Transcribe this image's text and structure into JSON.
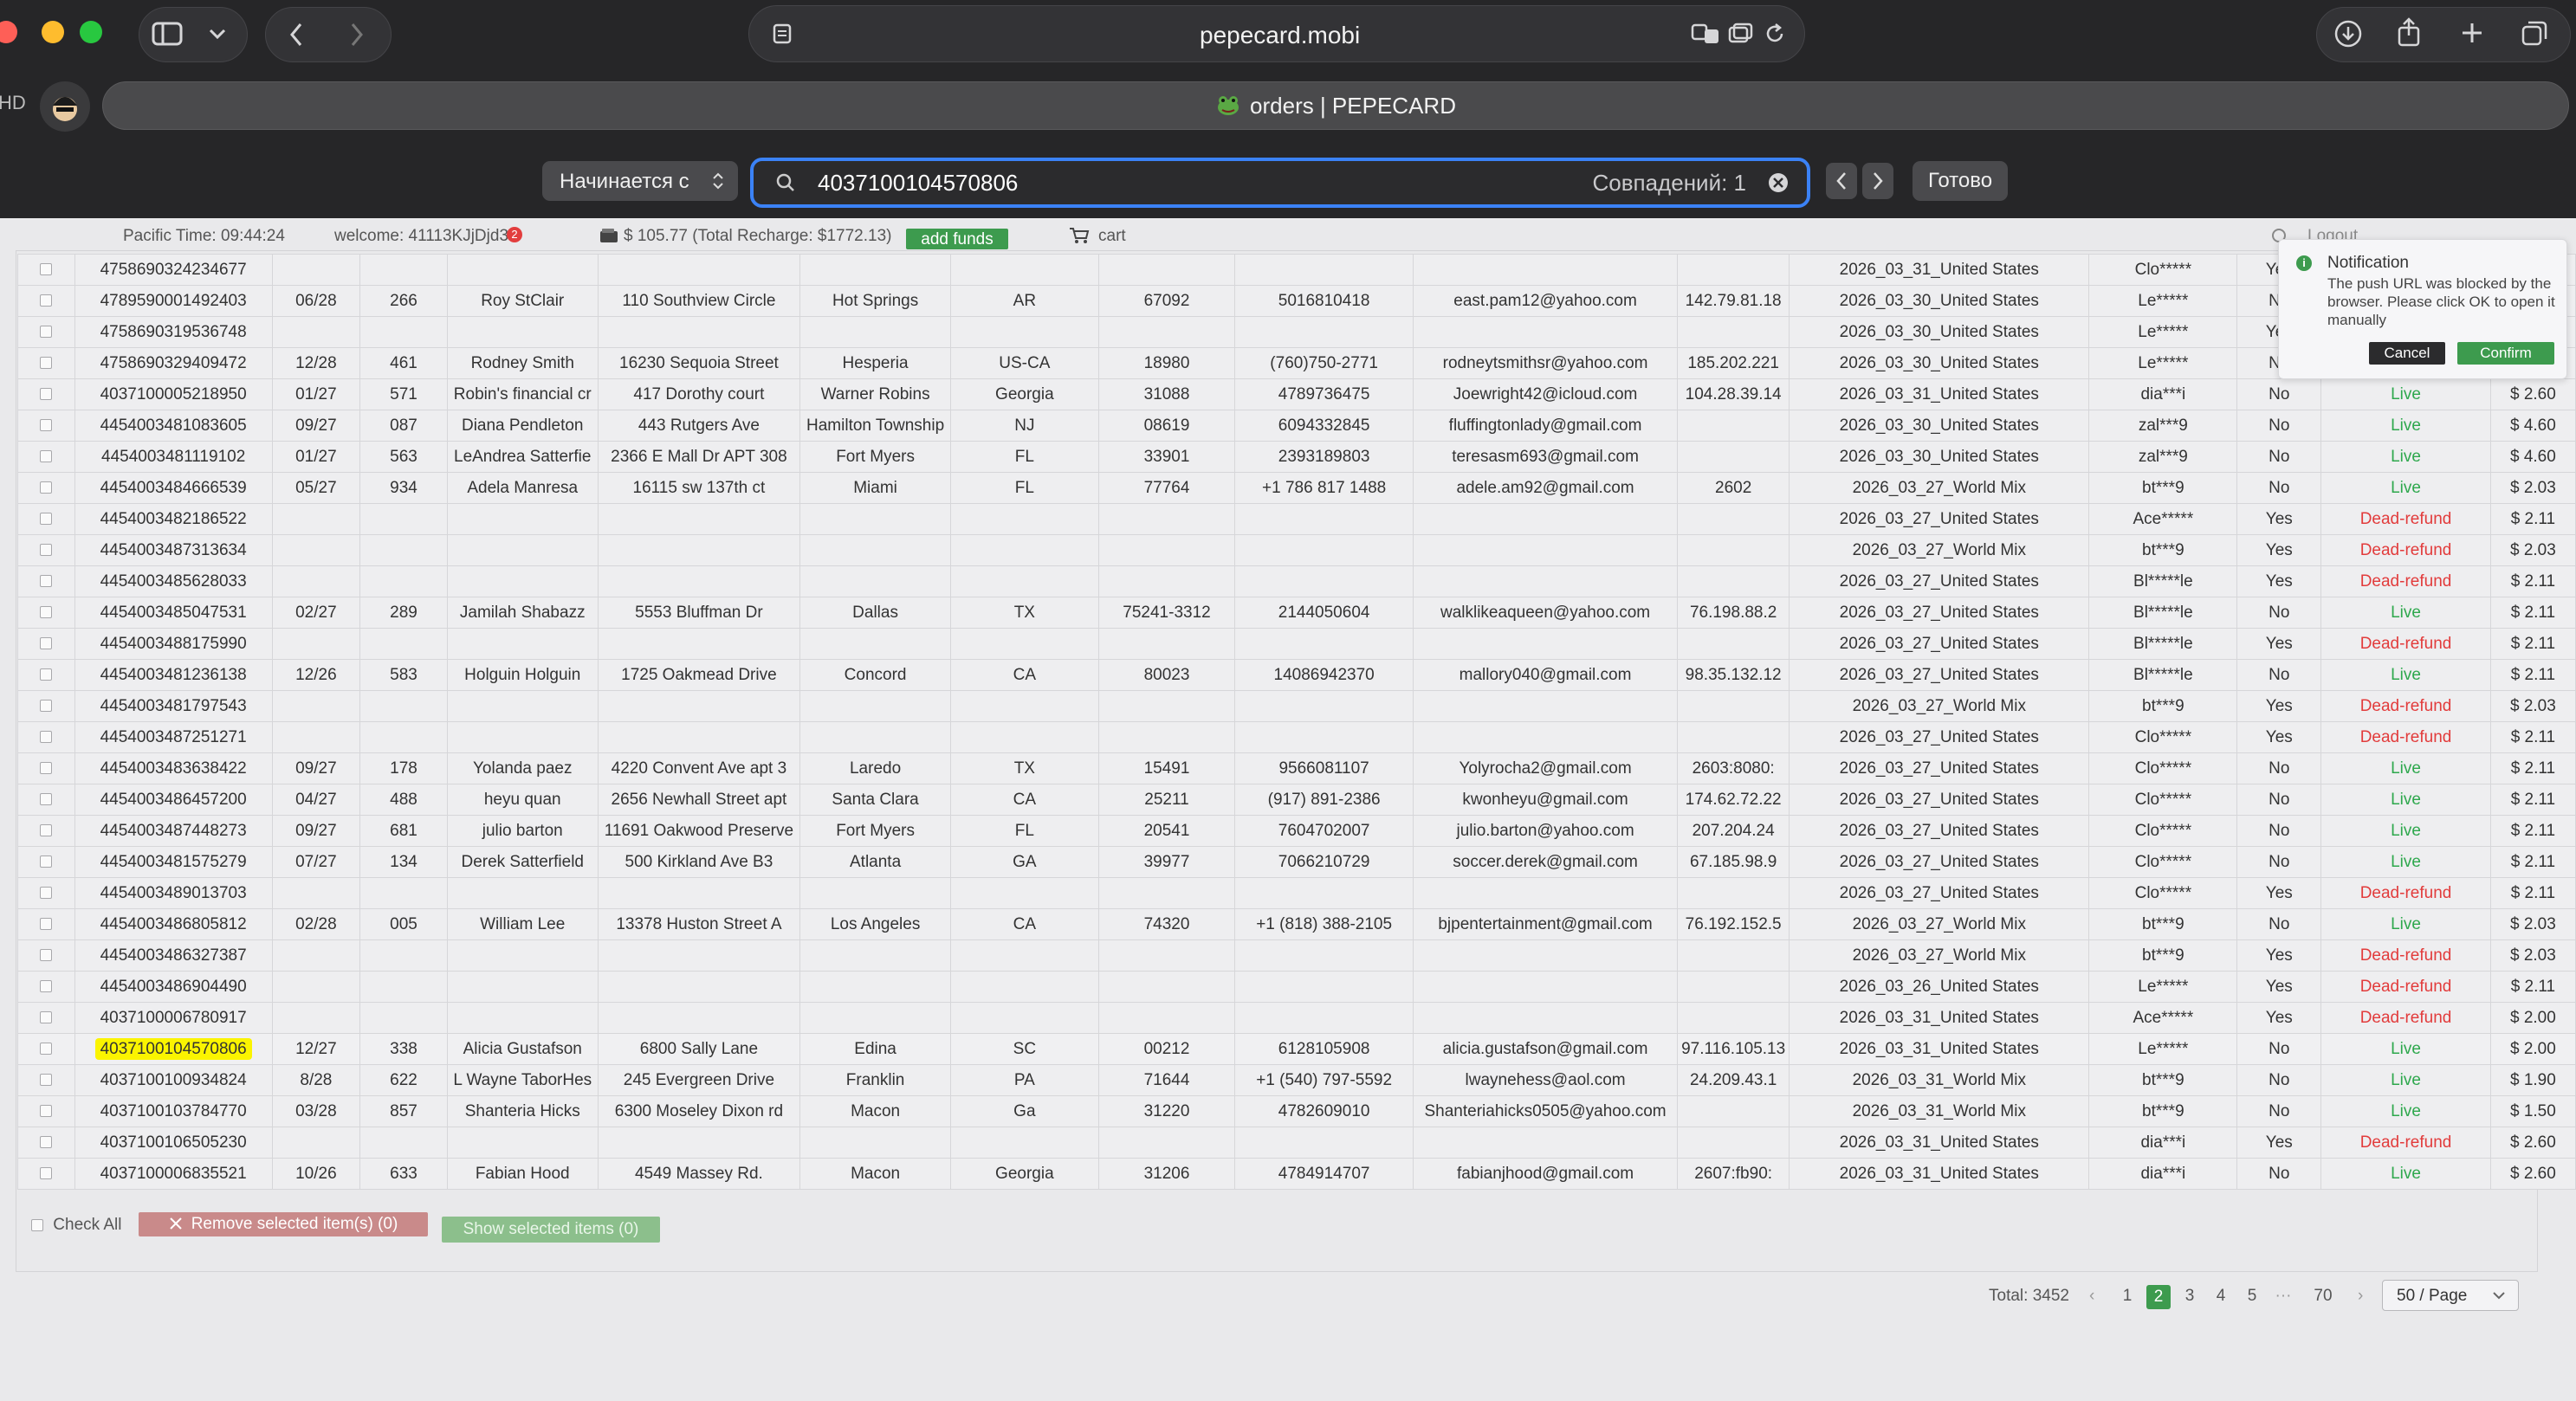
{
  "browser": {
    "address": "pepecard.mobi",
    "tab_title": "orders | PEPECARD",
    "profile_label": "HD",
    "find": {
      "mode": "Начинается с",
      "query": "4037100104570806",
      "matches": "Совпадений: 1",
      "done": "Готово"
    }
  },
  "header": {
    "time": "Pacific Time: 09:44:24",
    "welcome": "welcome: 41113KJjDjd3",
    "badge": "2",
    "balance": "$ 105.77 (Total Recharge: $1772.13)",
    "add_funds": "add funds",
    "cart": "cart",
    "logout": "Logout"
  },
  "notification": {
    "title": "Notification",
    "message": "The push URL was blocked by the browser. Please click OK to open it manually",
    "cancel": "Cancel",
    "confirm": "Confirm"
  },
  "rows": [
    {
      "card": "4758690324234677",
      "exp": "",
      "cvv": "",
      "name": "",
      "address": "",
      "city": "",
      "state": "",
      "zip": "",
      "phone": "",
      "email": "",
      "ip": "",
      "base": "2026_03_31_United States",
      "seller": "Clo*****",
      "refunded": "Yes",
      "status": "",
      "price": ""
    },
    {
      "card": "4789590001492403",
      "exp": "06/28",
      "cvv": "266",
      "name": "Roy StClair",
      "address": "110 Southview Circle",
      "city": "Hot Springs",
      "state": "AR",
      "zip": "67092",
      "phone": "5016810418",
      "email": "east.pam12@yahoo.com",
      "ip": "142.79.81.18",
      "base": "2026_03_30_United States",
      "seller": "Le*****",
      "refunded": "No",
      "status": "",
      "price": ""
    },
    {
      "card": "4758690319536748",
      "exp": "",
      "cvv": "",
      "name": "",
      "address": "",
      "city": "",
      "state": "",
      "zip": "",
      "phone": "",
      "email": "",
      "ip": "",
      "base": "2026_03_30_United States",
      "seller": "Le*****",
      "refunded": "Yes",
      "status": "",
      "price": ""
    },
    {
      "card": "4758690329409472",
      "exp": "12/28",
      "cvv": "461",
      "name": "Rodney Smith",
      "address": "16230 Sequoia Street",
      "city": "Hesperia",
      "state": "US-CA",
      "zip": "18980",
      "phone": "(760)750-2771",
      "email": "rodneytsmithsr@yahoo.com",
      "ip": "185.202.221",
      "base": "2026_03_30_United States",
      "seller": "Le*****",
      "refunded": "No",
      "status": "",
      "price": ""
    },
    {
      "card": "4037100005218950",
      "exp": "01/27",
      "cvv": "571",
      "name": "Robin's financial cr",
      "address": "417 Dorothy court",
      "city": "Warner Robins",
      "state": "Georgia",
      "zip": "31088",
      "phone": "4789736475",
      "email": "Joewright42@icloud.com",
      "ip": "104.28.39.14",
      "base": "2026_03_31_United States",
      "seller": "dia***i",
      "refunded": "No",
      "status": "Live",
      "price": "$ 2.60"
    },
    {
      "card": "4454003481083605",
      "exp": "09/27",
      "cvv": "087",
      "name": "Diana Pendleton",
      "address": "443 Rutgers Ave",
      "city": "Hamilton Township",
      "state": "NJ",
      "zip": "08619",
      "phone": "6094332845",
      "email": "fluffingtonlady@gmail.com",
      "ip": "",
      "base": "2026_03_30_United States",
      "seller": "zal***9",
      "refunded": "No",
      "status": "Live",
      "price": "$ 4.60"
    },
    {
      "card": "4454003481119102",
      "exp": "01/27",
      "cvv": "563",
      "name": "LeAndrea Satterfie",
      "address": "2366 E Mall Dr APT 308",
      "city": "Fort Myers",
      "state": "FL",
      "zip": "33901",
      "phone": "2393189803",
      "email": "teresasm693@gmail.com",
      "ip": "",
      "base": "2026_03_30_United States",
      "seller": "zal***9",
      "refunded": "No",
      "status": "Live",
      "price": "$ 4.60"
    },
    {
      "card": "4454003484666539",
      "exp": "05/27",
      "cvv": "934",
      "name": "Adela Manresa",
      "address": "16115 sw 137th ct",
      "city": "Miami",
      "state": "FL",
      "zip": "77764",
      "phone": "+1 786 817 1488",
      "email": "adele.am92@gmail.com",
      "ip": "2602",
      "base": "2026_03_27_World Mix",
      "seller": "bt***9",
      "refunded": "No",
      "status": "Live",
      "price": "$ 2.03"
    },
    {
      "card": "4454003482186522",
      "exp": "",
      "cvv": "",
      "name": "",
      "address": "",
      "city": "",
      "state": "",
      "zip": "",
      "phone": "",
      "email": "",
      "ip": "",
      "base": "2026_03_27_United States",
      "seller": "Ace*****",
      "refunded": "Yes",
      "status": "Dead-refund",
      "price": "$ 2.11"
    },
    {
      "card": "4454003487313634",
      "exp": "",
      "cvv": "",
      "name": "",
      "address": "",
      "city": "",
      "state": "",
      "zip": "",
      "phone": "",
      "email": "",
      "ip": "",
      "base": "2026_03_27_World Mix",
      "seller": "bt***9",
      "refunded": "Yes",
      "status": "Dead-refund",
      "price": "$ 2.03"
    },
    {
      "card": "4454003485628033",
      "exp": "",
      "cvv": "",
      "name": "",
      "address": "",
      "city": "",
      "state": "",
      "zip": "",
      "phone": "",
      "email": "",
      "ip": "",
      "base": "2026_03_27_United States",
      "seller": "Bl*****le",
      "refunded": "Yes",
      "status": "Dead-refund",
      "price": "$ 2.11"
    },
    {
      "card": "4454003485047531",
      "exp": "02/27",
      "cvv": "289",
      "name": "Jamilah Shabazz",
      "address": "5553 Bluffman Dr",
      "city": "Dallas",
      "state": "TX",
      "zip": "75241-3312",
      "phone": "2144050604",
      "email": "walklikeaqueen@yahoo.com",
      "ip": "76.198.88.2",
      "base": "2026_03_27_United States",
      "seller": "Bl*****le",
      "refunded": "No",
      "status": "Live",
      "price": "$ 2.11"
    },
    {
      "card": "4454003488175990",
      "exp": "",
      "cvv": "",
      "name": "",
      "address": "",
      "city": "",
      "state": "",
      "zip": "",
      "phone": "",
      "email": "",
      "ip": "",
      "base": "2026_03_27_United States",
      "seller": "Bl*****le",
      "refunded": "Yes",
      "status": "Dead-refund",
      "price": "$ 2.11"
    },
    {
      "card": "4454003481236138",
      "exp": "12/26",
      "cvv": "583",
      "name": "Holguin Holguin",
      "address": "1725 Oakmead Drive",
      "city": "Concord",
      "state": "CA",
      "zip": "80023",
      "phone": "14086942370",
      "email": "mallory040@gmail.com",
      "ip": "98.35.132.12",
      "base": "2026_03_27_United States",
      "seller": "Bl*****le",
      "refunded": "No",
      "status": "Live",
      "price": "$ 2.11"
    },
    {
      "card": "4454003481797543",
      "exp": "",
      "cvv": "",
      "name": "",
      "address": "",
      "city": "",
      "state": "",
      "zip": "",
      "phone": "",
      "email": "",
      "ip": "",
      "base": "2026_03_27_World Mix",
      "seller": "bt***9",
      "refunded": "Yes",
      "status": "Dead-refund",
      "price": "$ 2.03"
    },
    {
      "card": "4454003487251271",
      "exp": "",
      "cvv": "",
      "name": "",
      "address": "",
      "city": "",
      "state": "",
      "zip": "",
      "phone": "",
      "email": "",
      "ip": "",
      "base": "2026_03_27_United States",
      "seller": "Clo*****",
      "refunded": "Yes",
      "status": "Dead-refund",
      "price": "$ 2.11"
    },
    {
      "card": "4454003483638422",
      "exp": "09/27",
      "cvv": "178",
      "name": "Yolanda paez",
      "address": "4220 Convent Ave apt 3",
      "city": "Laredo",
      "state": "TX",
      "zip": "15491",
      "phone": "9566081107",
      "email": "Yolyrocha2@gmail.com",
      "ip": "2603:8080:",
      "base": "2026_03_27_United States",
      "seller": "Clo*****",
      "refunded": "No",
      "status": "Live",
      "price": "$ 2.11"
    },
    {
      "card": "4454003486457200",
      "exp": "04/27",
      "cvv": "488",
      "name": "heyu quan",
      "address": "2656 Newhall Street apt",
      "city": "Santa Clara",
      "state": "CA",
      "zip": "25211",
      "phone": "(917) 891-2386",
      "email": "kwonheyu@gmail.com",
      "ip": "174.62.72.22",
      "base": "2026_03_27_United States",
      "seller": "Clo*****",
      "refunded": "No",
      "status": "Live",
      "price": "$ 2.11"
    },
    {
      "card": "4454003487448273",
      "exp": "09/27",
      "cvv": "681",
      "name": "julio barton",
      "address": "11691 Oakwood Preserve",
      "city": "Fort Myers",
      "state": "FL",
      "zip": "20541",
      "phone": "7604702007",
      "email": "julio.barton@yahoo.com",
      "ip": "207.204.24",
      "base": "2026_03_27_United States",
      "seller": "Clo*****",
      "refunded": "No",
      "status": "Live",
      "price": "$ 2.11"
    },
    {
      "card": "4454003481575279",
      "exp": "07/27",
      "cvv": "134",
      "name": "Derek Satterfield",
      "address": "500 Kirkland Ave B3",
      "city": "Atlanta",
      "state": "GA",
      "zip": "39977",
      "phone": "7066210729",
      "email": "soccer.derek@gmail.com",
      "ip": "67.185.98.9",
      "base": "2026_03_27_United States",
      "seller": "Clo*****",
      "refunded": "No",
      "status": "Live",
      "price": "$ 2.11"
    },
    {
      "card": "4454003489013703",
      "exp": "",
      "cvv": "",
      "name": "",
      "address": "",
      "city": "",
      "state": "",
      "zip": "",
      "phone": "",
      "email": "",
      "ip": "",
      "base": "2026_03_27_United States",
      "seller": "Clo*****",
      "refunded": "Yes",
      "status": "Dead-refund",
      "price": "$ 2.11"
    },
    {
      "card": "4454003486805812",
      "exp": "02/28",
      "cvv": "005",
      "name": "William Lee",
      "address": "13378 Huston Street A",
      "city": "Los Angeles",
      "state": "CA",
      "zip": "74320",
      "phone": "+1 (818) 388-2105",
      "email": "bjpentertainment@gmail.com",
      "ip": "76.192.152.5",
      "base": "2026_03_27_World Mix",
      "seller": "bt***9",
      "refunded": "No",
      "status": "Live",
      "price": "$ 2.03"
    },
    {
      "card": "4454003486327387",
      "exp": "",
      "cvv": "",
      "name": "",
      "address": "",
      "city": "",
      "state": "",
      "zip": "",
      "phone": "",
      "email": "",
      "ip": "",
      "base": "2026_03_27_World Mix",
      "seller": "bt***9",
      "refunded": "Yes",
      "status": "Dead-refund",
      "price": "$ 2.03"
    },
    {
      "card": "4454003486904490",
      "exp": "",
      "cvv": "",
      "name": "",
      "address": "",
      "city": "",
      "state": "",
      "zip": "",
      "phone": "",
      "email": "",
      "ip": "",
      "base": "2026_03_26_United States",
      "seller": "Le*****",
      "refunded": "Yes",
      "status": "Dead-refund",
      "price": "$ 2.11"
    },
    {
      "card": "4037100006780917",
      "exp": "",
      "cvv": "",
      "name": "",
      "address": "",
      "city": "",
      "state": "",
      "zip": "",
      "phone": "",
      "email": "",
      "ip": "",
      "base": "2026_03_31_United States",
      "seller": "Ace*****",
      "refunded": "Yes",
      "status": "Dead-refund",
      "price": "$ 2.00"
    },
    {
      "card": "4037100104570806",
      "exp": "12/27",
      "cvv": "338",
      "name": "Alicia Gustafson",
      "address": "6800 Sally Lane",
      "city": "Edina",
      "state": "SC",
      "zip": "00212",
      "phone": "6128105908",
      "email": "alicia.gustafson@gmail.com",
      "ip": "97.116.105.13",
      "base": "2026_03_31_United States",
      "seller": "Le*****",
      "refunded": "No",
      "status": "Live",
      "price": "$ 2.00",
      "highlight": true
    },
    {
      "card": "4037100100934824",
      "exp": "8/28",
      "cvv": "622",
      "name": "L Wayne TaborHes",
      "address": "245 Evergreen Drive",
      "city": "Franklin",
      "state": "PA",
      "zip": "71644",
      "phone": "+1 (540) 797-5592",
      "email": "lwaynehess@aol.com",
      "ip": "24.209.43.1",
      "base": "2026_03_31_World Mix",
      "seller": "bt***9",
      "refunded": "No",
      "status": "Live",
      "price": "$ 1.90"
    },
    {
      "card": "4037100103784770",
      "exp": "03/28",
      "cvv": "857",
      "name": "Shanteria Hicks",
      "address": "6300 Moseley Dixon rd",
      "city": "Macon",
      "state": "Ga",
      "zip": "31220",
      "phone": "4782609010",
      "email": "Shanteriahicks0505@yahoo.com",
      "ip": "",
      "base": "2026_03_31_World Mix",
      "seller": "bt***9",
      "refunded": "No",
      "status": "Live",
      "price": "$ 1.50"
    },
    {
      "card": "4037100106505230",
      "exp": "",
      "cvv": "",
      "name": "",
      "address": "",
      "city": "",
      "state": "",
      "zip": "",
      "phone": "",
      "email": "",
      "ip": "",
      "base": "2026_03_31_United States",
      "seller": "dia***i",
      "refunded": "Yes",
      "status": "Dead-refund",
      "price": "$ 2.60"
    },
    {
      "card": "4037100006835521",
      "exp": "10/26",
      "cvv": "633",
      "name": "Fabian Hood",
      "address": "4549 Massey Rd.",
      "city": "Macon",
      "state": "Georgia",
      "zip": "31206",
      "phone": "4784914707",
      "email": "fabianjhood@gmail.com",
      "ip": "2607:fb90:",
      "base": "2026_03_31_United States",
      "seller": "dia***i",
      "refunded": "No",
      "status": "Live",
      "price": "$ 2.60"
    }
  ],
  "footer": {
    "check_all": "Check All",
    "remove": "Remove selected item(s) (0)",
    "show": "Show selected items (0)",
    "total": "Total: 3452",
    "pages": [
      "1",
      "2",
      "3",
      "4",
      "5",
      "···",
      "70"
    ],
    "active_page": "2",
    "page_size": "50 / Page"
  },
  "colors": {
    "live": "#2ea84d",
    "dead": "#e23b3b",
    "accent_green": "#3d9b4e",
    "find_highlight": "#fbf400"
  }
}
